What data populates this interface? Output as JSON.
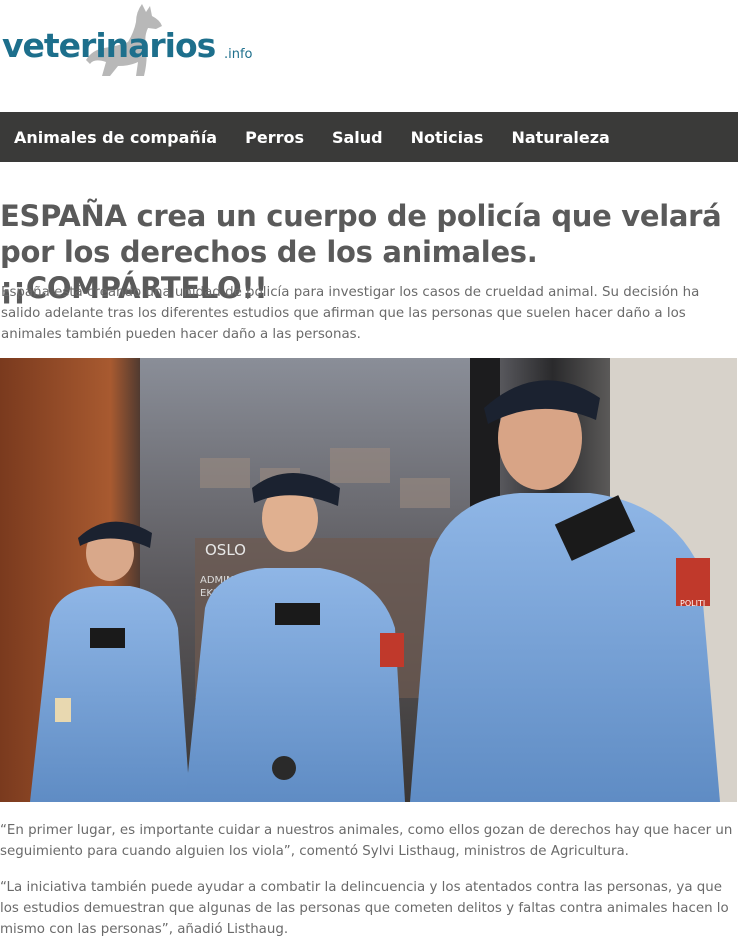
{
  "site": {
    "logo_text": "veterinarios",
    "logo_suffix": ".info"
  },
  "nav": {
    "items": [
      "Animales de compañía",
      "Perros",
      "Salud",
      "Noticias",
      "Naturaleza"
    ]
  },
  "article": {
    "title": "ESPAÑA crea un cuerpo de policía que velará por los derechos de los animales. ¡¡COMPÁRTELO!!",
    "lead": "España está creando una unidad de policía para investigar los casos de crueldad animal. Su decisión ha salido adelante tras los diferentes estudios que afirman que las personas que suelen hacer daño a los animales también pueden hacer daño a las personas.",
    "image_text": {
      "sign_line1": "OSLO",
      "sign_line2": "ADMINISTR",
      "sign_line3": "EKSPE",
      "badge": "POLITI"
    },
    "paragraphs": [
      "“En primer lugar, es importante cuidar a nuestros animales, como ellos gozan de derechos hay que hacer un seguimiento para cuando alguien los viola”, comentó Sylvi Listhaug, ministros de Agricultura.",
      "“La iniciativa también puede ayudar a combatir la delincuencia y los atentados contra las personas, ya que los estudios demuestran que algunas de las personas que cometen delitos y faltas contra animales hacen lo mismo con las personas”, añadió Listhaug."
    ]
  },
  "colors": {
    "brand": "#1d6f8c",
    "nav_bg": "#3a3a39",
    "title": "#5a5a5a",
    "uniform": "#7aa6d8"
  }
}
